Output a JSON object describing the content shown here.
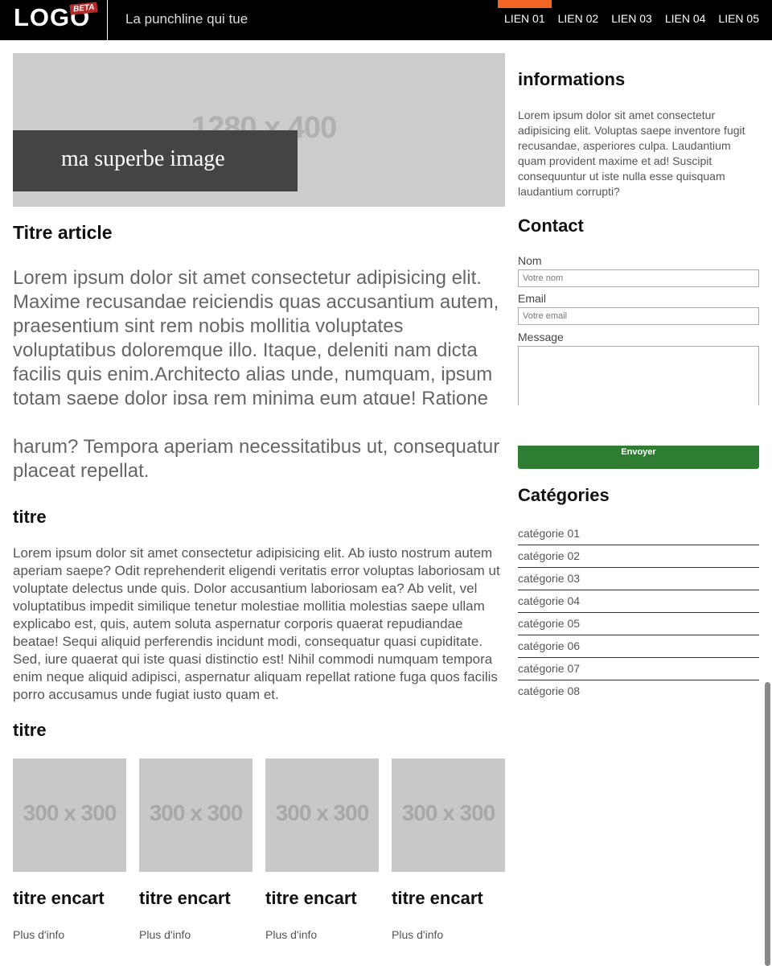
{
  "header": {
    "logo": "LOGO",
    "badge": "BETA",
    "punchline": "La punchline qui tue",
    "nav": [
      "LIEN 01",
      "LIEN 02",
      "LIEN 03",
      "LIEN 04",
      "LIEN 05"
    ],
    "active_nav": "LIEN 01",
    "accent_color": "#f26522"
  },
  "hero": {
    "placeholder": "1280 x 400",
    "caption": "ma superbe image"
  },
  "article": {
    "title": "Titre article",
    "lead": "Lorem ipsum dolor sit amet consectetur adipisicing elit. Maxime recusandae reiciendis quas accusantium autem, praesentium sint rem nobis mollitia voluptates voluptatibus doloremque illo. Itaque, deleniti nam dicta facilis quis enim.Architecto alias unde, numquam, ipsum totam saepe dolor ipsa rem minima eum atque! Ratione",
    "lead_tail": "harum? Tempora aperiam necessitatibus ut, consequatur\nplaceat repellat.",
    "section1_title": "titre",
    "section1_text": "Lorem ipsum dolor sit amet consectetur adipisicing elit. Ab iusto nostrum autem aperiam saepe? Odit reprehenderit eligendi veritatis error voluptas laboriosam ut voluptate delectus unde quis. Dolor accusantium laboriosam ea? Ab velit, vel voluptatibus impedit similique tenetur molestiae mollitia molestias saepe ullam explicabo est, quis, autem soluta aspernatur corporis quaerat repudiandae beatae! Sequi aliquid perferendis incidunt modi, consequatur quasi cupiditate. Sed, iure quaerat qui iste quasi distinctio est! Nihil commodi numquam tempora enim neque aliquid adipisci, aspernatur aliquam repellat ratione fuga quos facilis porro accusamus unde fugiat iusto quam et.",
    "section2_title": "titre"
  },
  "cards": [
    {
      "placeholder": "300 x 300",
      "title": "titre encart",
      "link": "Plus d'info"
    },
    {
      "placeholder": "300 x 300",
      "title": "titre encart",
      "link": "Plus d'info"
    },
    {
      "placeholder": "300 x 300",
      "title": "titre encart",
      "link": "Plus d'info"
    },
    {
      "placeholder": "300 x 300",
      "title": "titre encart",
      "link": "Plus d'info"
    }
  ],
  "sidebar": {
    "info_title": "informations",
    "info_text": "Lorem ipsum dolor sit amet consectetur adipisicing elit. Voluptas saepe inventore fugit recusandae, asperiores culpa. Laudantium quam provident maxime et ad! Suscipit consequuntur ut iste nulla esse quisquam laudantium corrupti?",
    "contact_title": "Contact",
    "name_label": "Nom",
    "name_placeholder": "Votre nom",
    "email_label": "Email",
    "email_placeholder": "Votre email",
    "message_label": "Message",
    "send_label": "Envoyer",
    "send_color": "#2e7d32",
    "categories_title": "Catégories",
    "categories": [
      "catégorie 01",
      "catégorie 02",
      "catégorie 03",
      "catégorie 04",
      "catégorie 05",
      "catégorie 06",
      "catégorie 07",
      "catégorie 08"
    ]
  }
}
